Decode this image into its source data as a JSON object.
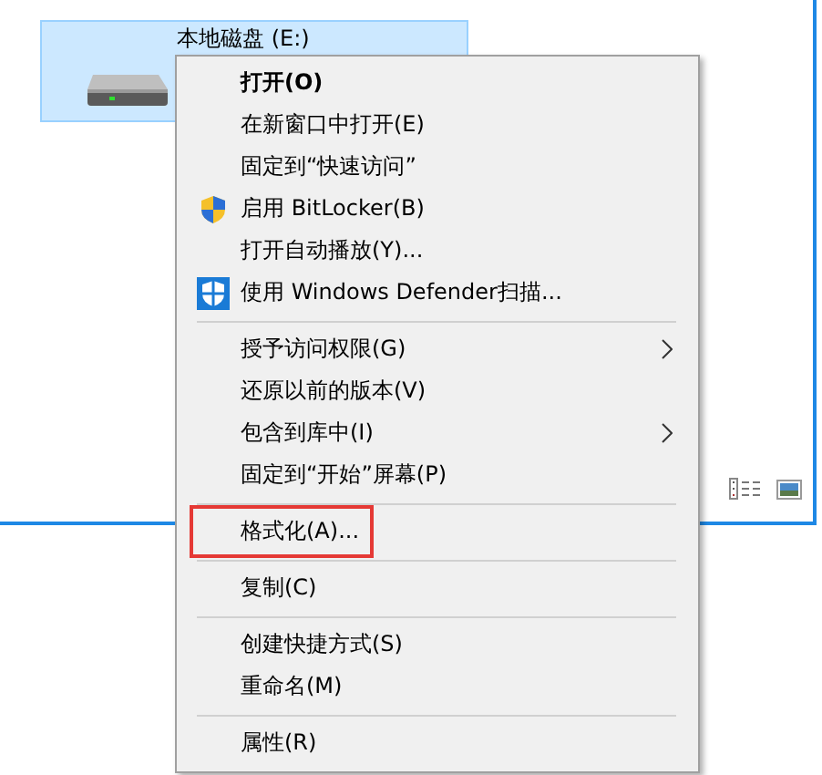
{
  "drive": {
    "label": "本地磁盘 (E:)",
    "selected": true
  },
  "menu": {
    "groups": [
      {
        "items": [
          {
            "kind": "plain",
            "label": "打开(O)",
            "bold": true
          },
          {
            "kind": "plain",
            "label": "在新窗口中打开(E)"
          },
          {
            "kind": "plain",
            "label": "固定到“快速访问”"
          },
          {
            "kind": "elevated",
            "label": "启用 BitLocker(B)"
          },
          {
            "kind": "plain",
            "label": "打开自动播放(Y)..."
          },
          {
            "kind": "scan",
            "label": "使用 Windows Defender扫描..."
          }
        ]
      },
      {
        "items": [
          {
            "kind": "plain",
            "label": "授予访问权限(G)",
            "submenu": true
          },
          {
            "kind": "plain",
            "label": "还原以前的版本(V)"
          },
          {
            "kind": "plain",
            "label": "包含到库中(I)",
            "submenu": true
          },
          {
            "kind": "plain",
            "label": "固定到“开始”屏幕(P)"
          }
        ]
      },
      {
        "items": [
          {
            "kind": "plain",
            "label": "格式化(A)...",
            "highlighted": true
          }
        ]
      },
      {
        "items": [
          {
            "kind": "plain",
            "label": "复制(C)"
          }
        ]
      },
      {
        "items": [
          {
            "kind": "plain",
            "label": "创建快捷方式(S)"
          },
          {
            "kind": "plain",
            "label": "重命名(M)"
          }
        ]
      },
      {
        "items": [
          {
            "kind": "plain",
            "label": "属性(R)"
          }
        ]
      }
    ]
  }
}
